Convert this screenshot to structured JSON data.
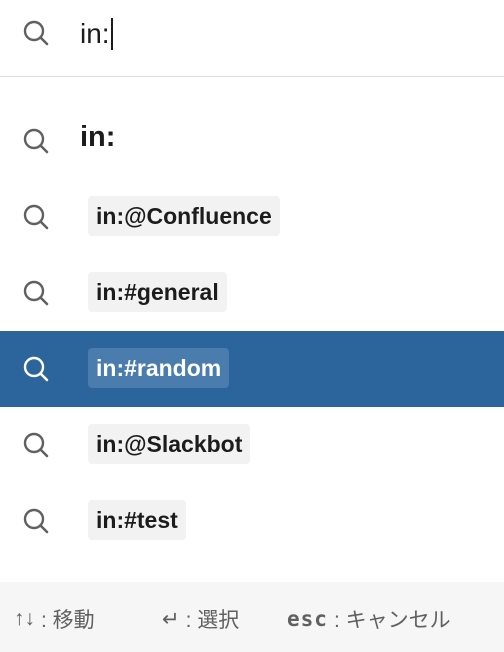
{
  "search": {
    "query": "in:"
  },
  "results": [
    {
      "label": "in:",
      "selected": false
    },
    {
      "label": "in:@Confluence",
      "selected": false
    },
    {
      "label": "in:#general",
      "selected": false
    },
    {
      "label": "in:#random",
      "selected": true
    },
    {
      "label": "in:@Slackbot",
      "selected": false
    },
    {
      "label": "in:#test",
      "selected": false
    }
  ],
  "footer": {
    "navigate_keys": "↑↓",
    "navigate_label": ": 移動",
    "select_key": "↵",
    "select_label": ": 選択",
    "cancel_key": "esc",
    "cancel_label": ": キャンセル"
  },
  "colors": {
    "selected_row": "#2c649c",
    "selected_chip": "#4a7cad",
    "chip": "#f2f2f2",
    "footer_bg": "#f6f6f6"
  },
  "icons": {
    "search": "search-icon"
  }
}
